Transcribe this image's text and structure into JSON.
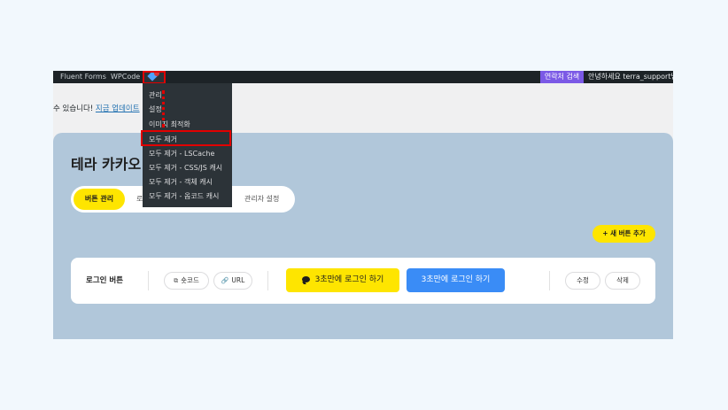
{
  "adminbar": {
    "items": [
      "Fluent Forms",
      "WPCode"
    ],
    "plugin_icon": "litespeed-diamond-icon",
    "search_tag": "연락처 검색",
    "greeting": "안녕하세요 terra_support님"
  },
  "notice": {
    "text": "수 있습니다!",
    "link": "지금 업데이트"
  },
  "dropdown": {
    "items": [
      "관리",
      "설정",
      "이미지 최적화",
      "모두 제거",
      "모두 제거 - LSCache",
      "모두 제거 - CSS/JS 캐시",
      "모두 제거 - 객체 캐시",
      "모두 제거 - 옵코드 캐시"
    ]
  },
  "page": {
    "title": "테라 카카오",
    "tabs": [
      "버튼 관리",
      "로",
      "관리자 설정"
    ],
    "add_button": "+ 새 버튼 추가"
  },
  "card": {
    "label": "로그인 버튼",
    "shortcode": "숏코드",
    "shortcode_icon": "copy-icon",
    "url": "URL",
    "url_icon": "link-icon",
    "kakao_button": "3초만에 로그인 하기",
    "kakao_icon": "speech-bubble-icon",
    "blue_button": "3초만에 로그인 하기",
    "edit": "수정",
    "delete": "삭제"
  },
  "colors": {
    "admin_bar": "#1d2327",
    "panel": "#b1c7da",
    "kakao_yellow": "#fee500",
    "blue": "#3a8cf6",
    "highlight": "#e10000"
  }
}
